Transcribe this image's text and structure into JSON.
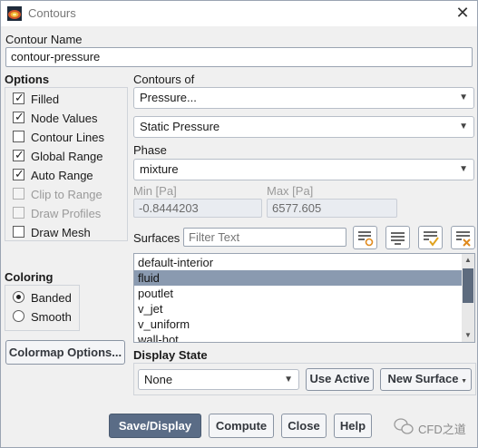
{
  "window": {
    "title": "Contours",
    "close_glyph": "✕"
  },
  "contour_name": {
    "label": "Contour Name",
    "value": "contour-pressure"
  },
  "options": {
    "label": "Options",
    "items": [
      {
        "label": "Filled",
        "checked": true,
        "enabled": true
      },
      {
        "label": "Node Values",
        "checked": true,
        "enabled": true
      },
      {
        "label": "Contour Lines",
        "checked": false,
        "enabled": true
      },
      {
        "label": "Global Range",
        "checked": true,
        "enabled": true
      },
      {
        "label": "Auto Range",
        "checked": true,
        "enabled": true
      },
      {
        "label": "Clip to Range",
        "checked": false,
        "enabled": false
      },
      {
        "label": "Draw Profiles",
        "checked": false,
        "enabled": false
      },
      {
        "label": "Draw Mesh",
        "checked": false,
        "enabled": true
      }
    ]
  },
  "coloring": {
    "label": "Coloring",
    "items": [
      {
        "label": "Banded",
        "selected": true
      },
      {
        "label": "Smooth",
        "selected": false
      }
    ]
  },
  "colormap_button": "Colormap Options...",
  "contours_of": {
    "label": "Contours of",
    "category": "Pressure...",
    "variable": "Static Pressure"
  },
  "phase": {
    "label": "Phase",
    "value": "mixture"
  },
  "min": {
    "label": "Min [Pa]",
    "value": "-0.8444203"
  },
  "max": {
    "label": "Max [Pa]",
    "value": "6577.605"
  },
  "surfaces": {
    "label": "Surfaces",
    "filter_placeholder": "Filter Text",
    "items": [
      {
        "label": "default-interior",
        "selected": false
      },
      {
        "label": "fluid",
        "selected": true
      },
      {
        "label": "poutlet",
        "selected": false
      },
      {
        "label": "v_jet",
        "selected": false
      },
      {
        "label": "v_uniform",
        "selected": false
      },
      {
        "label": "wall-hot",
        "selected": false
      }
    ]
  },
  "display_state": {
    "label": "Display State",
    "value": "None",
    "use_active": "Use Active",
    "new_surface": "New Surface"
  },
  "bottom_buttons": {
    "save_display": "Save/Display",
    "compute": "Compute",
    "close": "Close",
    "help": "Help"
  },
  "watermark": "CFD之道"
}
